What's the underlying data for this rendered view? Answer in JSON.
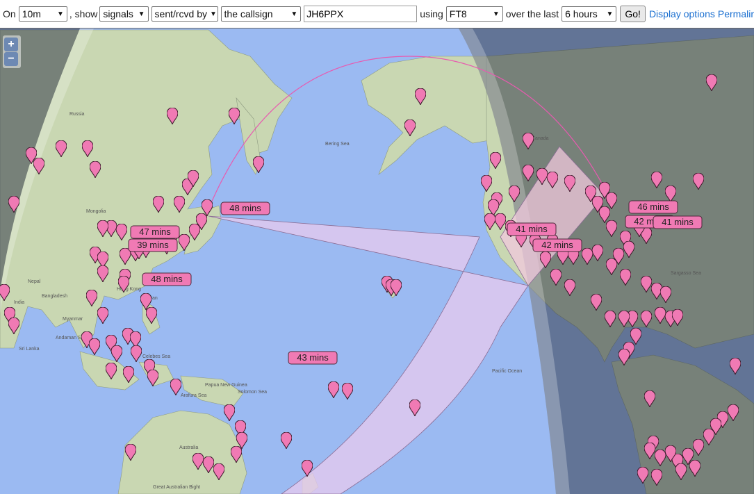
{
  "controls": {
    "on_label": "On",
    "band": "10m",
    "show_label": ", show",
    "show_what": "signals",
    "direction": "sent/rcvd by",
    "target_type": "the callsign",
    "callsign": "JH6PPX",
    "using_label": "using",
    "mode": "FT8",
    "over_label": "over the last",
    "period": "6 hours",
    "go_label": "Go!",
    "display_options_label": "Display options",
    "permalink_label": "Permalir"
  },
  "map": {
    "zoom_in": "+",
    "zoom_out": "−",
    "place_labels": {
      "russia": "Russia",
      "mongolia": "Mongolia",
      "india": "India",
      "bengal": "Bangladesh",
      "myanmar": "Myanmar",
      "andaman": "Andaman Sea",
      "srilanka": "Sri Lanka",
      "bering": "Bering Sea",
      "pacific": "Pacific Ocean",
      "papua": "Papua New Guinea",
      "solomon": "Solomon Sea",
      "arafura": "Arafura Sea",
      "australia": "Australia",
      "bight": "Great Australian Bight",
      "canada": "Canada",
      "sargasso": "Sargasso Sea",
      "nepal": "Nepal",
      "hongkong": "Hong Kong",
      "taiwan": "Taiwan",
      "celebes": "Celebes Sea"
    },
    "spot_labels": [
      {
        "id": "a",
        "text": "48 mins"
      },
      {
        "id": "b",
        "text": "47 mins"
      },
      {
        "id": "c",
        "text": "39 mins"
      },
      {
        "id": "d",
        "text": "48 mins"
      },
      {
        "id": "e",
        "text": "41 mins"
      },
      {
        "id": "f",
        "text": "46 mins"
      },
      {
        "id": "g",
        "text": "42 mins"
      },
      {
        "id": "h",
        "text": "41 mins"
      },
      {
        "id": "i",
        "text": "42 mins"
      },
      {
        "id": "j",
        "text": "43 mins"
      }
    ],
    "colors": {
      "ocean": "#9bbaf2",
      "land": "#c9d7b2",
      "night": "#333a4a",
      "marker": "#f07ab4",
      "label_bg": "#f07ab4",
      "path": "#d3b3e6",
      "link": "#1a6fd0"
    }
  }
}
